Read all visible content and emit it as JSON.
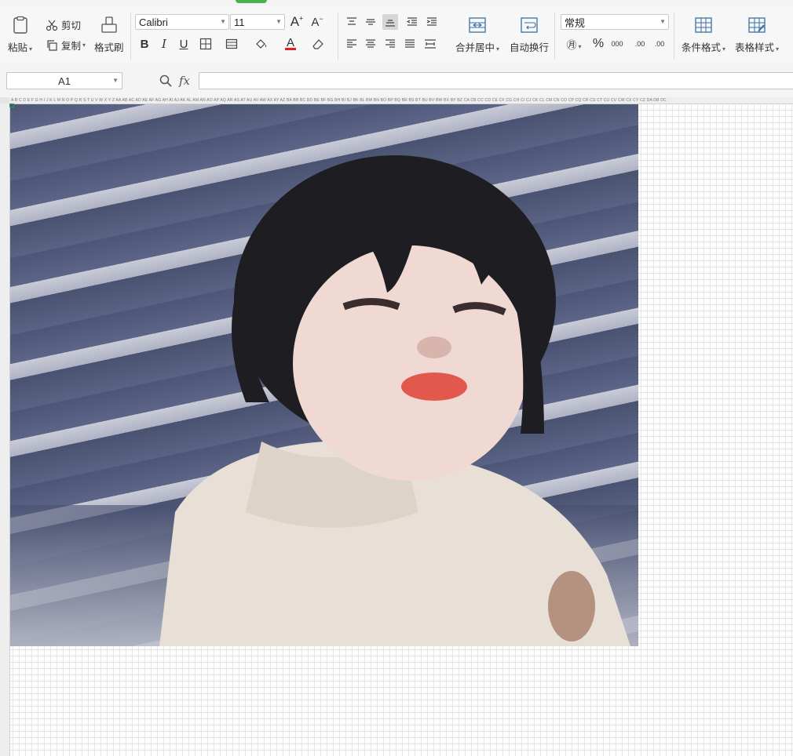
{
  "ribbon": {
    "clipboard": {
      "paste": "粘贴",
      "cut": "剪切",
      "copy": "复制",
      "format_painter": "格式刷"
    },
    "font": {
      "name": "Calibri",
      "size": "11",
      "bold": "B",
      "italic": "I",
      "underline": "U",
      "grow": "A⁺",
      "shrink": "A⁻",
      "font_color_glyph": "A"
    },
    "alignment": {
      "merge_center": "合并居中",
      "wrap_text": "自动换行"
    },
    "number": {
      "format": "常规",
      "percent": "%",
      "thousands": "000",
      "inc_decimal": ".00",
      "dec_decimal": ".00"
    },
    "styles": {
      "conditional_format": "条件格式",
      "table_style": "表格样式"
    }
  },
  "formula_bar": {
    "cell_ref": "A1",
    "fx_label": "fx",
    "formula_value": ""
  },
  "sheet": {
    "column_headers": [
      "A",
      "B",
      "C",
      "D",
      "E",
      "F",
      "G",
      "H",
      "I",
      "J",
      "K",
      "L",
      "M",
      "N",
      "O",
      "P",
      "Q",
      "R",
      "S",
      "T",
      "U",
      "V",
      "W",
      "X",
      "Y",
      "Z",
      "AA",
      "AB",
      "AC",
      "AD",
      "AE",
      "AF",
      "AG",
      "AH",
      "AI",
      "AJ",
      "AK",
      "AL",
      "AM",
      "AN",
      "AO",
      "AP",
      "AQ",
      "AR",
      "AS",
      "AT",
      "AU",
      "AV",
      "AW",
      "AX",
      "AY",
      "AZ",
      "BA",
      "BB",
      "BC",
      "BD",
      "BE",
      "BF",
      "BG",
      "BH",
      "BI",
      "BJ",
      "BK",
      "BL",
      "BM",
      "BN",
      "BO",
      "BP",
      "BQ",
      "BR",
      "BS",
      "BT",
      "BU",
      "BV",
      "BW",
      "BX",
      "BY",
      "BZ",
      "CA",
      "CB",
      "CC",
      "CD",
      "CE",
      "CF",
      "CG",
      "CH",
      "CI",
      "CJ",
      "CK",
      "CL",
      "CM",
      "CN",
      "CO",
      "CP",
      "CQ",
      "CR",
      "CS",
      "CT",
      "CU",
      "CV",
      "CW",
      "CX",
      "CY",
      "CZ",
      "DA",
      "DB",
      "DC"
    ]
  },
  "colors": {
    "selection": "#1f9d55",
    "ribbon_bg": "#f7f7f7",
    "grid": "#e4e4e4"
  }
}
